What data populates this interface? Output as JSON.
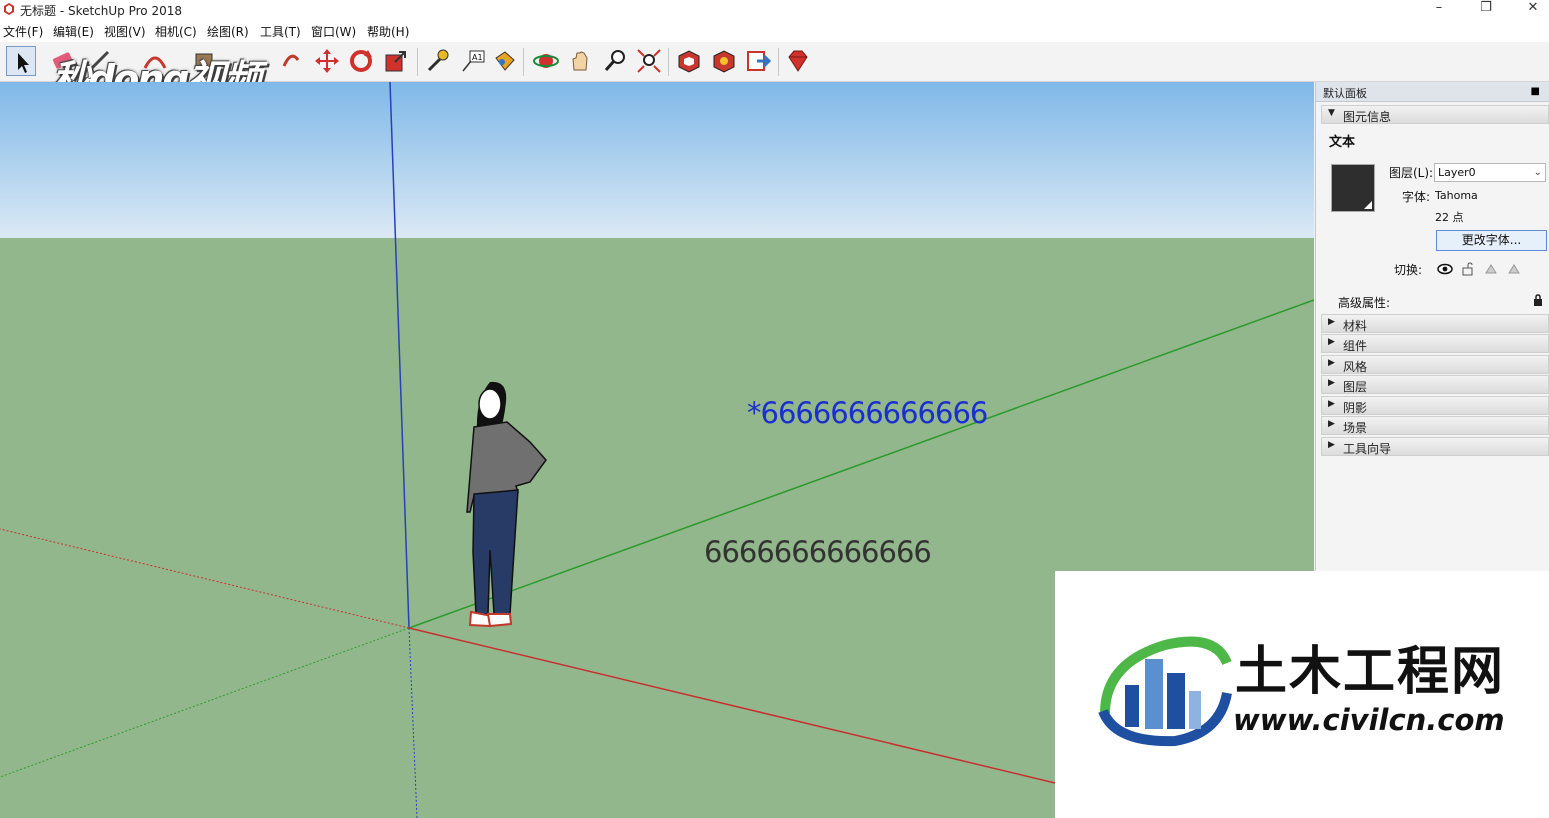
{
  "window": {
    "title": "无标题 - SketchUp Pro 2018",
    "minimize": "–",
    "maximize": "❐",
    "close": "✕"
  },
  "menu": {
    "file": "文件(F)",
    "edit": "编辑(E)",
    "view": "视图(V)",
    "camera": "相机(C)",
    "draw": "绘图(R)",
    "tools": "工具(T)",
    "window": "窗口(W)",
    "help": "帮助(H)"
  },
  "toolbar": {
    "icons": [
      "select-icon",
      "eraser-icon",
      "line-icon",
      "paint-icon",
      "rectangle-icon",
      "push-pull-icon",
      "move-icon",
      "rotate-icon",
      "scale-icon",
      "tape-measure-icon",
      "text-icon",
      "paint-bucket-icon",
      "orbit-icon",
      "pan-icon",
      "zoom-icon",
      "zoom-extents-icon",
      "warehouse-icon",
      "extension-icon",
      "send-icon",
      "ruby-icon"
    ]
  },
  "watermark": {
    "text": "秒dong视频"
  },
  "scene": {
    "text_selected": "*6666666666666",
    "text_normal": "6666666666666",
    "colors": {
      "sky_top": "#7fb8e8",
      "sky_bottom": "#dbe9f4",
      "ground": "#93b78c",
      "selected_text": "#1a2fcf",
      "normal_text": "#333333"
    }
  },
  "panel": {
    "title": "默认面板",
    "entity_info": {
      "tray_label": "图元信息",
      "type": "文本",
      "layer_label": "图层(L):",
      "layer_value": "Layer0",
      "font_label": "字体:",
      "font_value": "Tahoma",
      "size_value": "22 点",
      "change_font_button": "更改字体...",
      "toggle_label": "切换:",
      "advanced_label": "高级属性:"
    },
    "trays": [
      "材料",
      "组件",
      "风格",
      "图层",
      "阴影",
      "场景",
      "工具向导"
    ]
  },
  "logo": {
    "cn": "土木工程网",
    "url": "www.civilcn.com"
  }
}
